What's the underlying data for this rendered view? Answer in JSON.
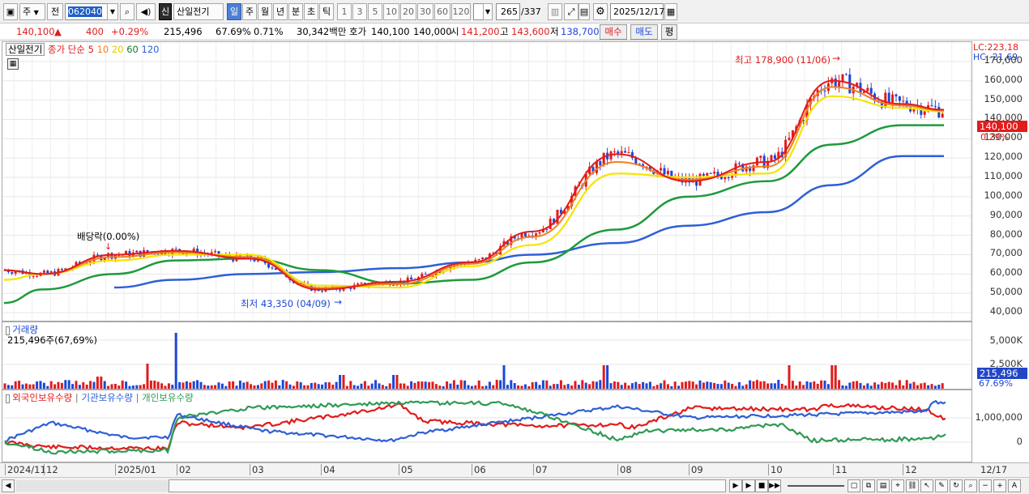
{
  "toolbar": {
    "period_select": "주",
    "view_select": "전",
    "stock_code": "062040",
    "stock_badge": "신",
    "stock_name": "산일전기",
    "periods": [
      "일",
      "주",
      "월",
      "년",
      "분",
      "초",
      "틱"
    ],
    "active_period": "일",
    "interval_buttons": [
      "1",
      "3",
      "5",
      "10",
      "20",
      "30",
      "60",
      "120"
    ],
    "count_value": "265",
    "count_total": "/337",
    "date_value": "2025/12/17"
  },
  "quote": {
    "price": "140,100",
    "change_arrow": "▲",
    "change": "400",
    "change_pct": "+0.29%",
    "volume": "215,496",
    "volume_ratio": "67.69%",
    "turnover_pct": "0.71%",
    "amount": "30,342백만",
    "ask_label": "호가",
    "ask": "140,100",
    "bid": "140,000",
    "open_label": "시",
    "open": "141,200",
    "high_label": "고",
    "high": "143,600",
    "low_label": "저",
    "low": "138,700",
    "buy_button": "매수",
    "sell_button": "매도",
    "eval_button": "평"
  },
  "price_panel": {
    "title": "산일전기",
    "legend_label": "종가 단순",
    "ma_labels": [
      "5",
      "10",
      "20",
      "60",
      "120"
    ],
    "lc": "LC:223,18",
    "hc": "HC:-21,69",
    "last_price_tag": "140,100",
    "last_pct_tag": "0.29%",
    "high_annotation": "최고 178,900 (11/06)",
    "low_annotation": "최저 43,350 (04/09)",
    "dividend_annotation": "배당락(0.00%)",
    "y_ticks": [
      "170,000",
      "160,000",
      "150,000",
      "140,000",
      "130,000",
      "120,000",
      "110,000",
      "100,000",
      "90,000",
      "80,000",
      "70,000",
      "60,000",
      "50,000",
      "40,000"
    ]
  },
  "volume_panel": {
    "title": "거래량",
    "info": "215,496주(67,69%)",
    "y_ticks": [
      "5,000K",
      "2,500K"
    ],
    "last_tag": "215,496",
    "last_pct": "67.69%"
  },
  "holding_panel": {
    "legend": [
      "외국인보유수량",
      "기관보유수량",
      "개인보유수량"
    ],
    "y_ticks": [
      "1,000,000",
      "0"
    ]
  },
  "dates": {
    "labels": [
      "2024/11",
      "12",
      "2025/01",
      "02",
      "03",
      "04",
      "05",
      "06",
      "07",
      "08",
      "09",
      "10",
      "11",
      "12"
    ],
    "right_label": "12/17"
  },
  "colors": {
    "up": "#e21b1b",
    "down": "#1c47d8",
    "ma5": "#e21b1b",
    "ma10": "#f08020",
    "ma20": "#f5e400",
    "ma60": "#1e9a3c",
    "ma120": "#2e5fd6",
    "foreign": "#e21b1b",
    "institution": "#2e5fd6",
    "individual": "#2f9a55"
  },
  "chart_data": {
    "type": "line",
    "title": "산일전기",
    "x": [
      "2024/11",
      "12",
      "2025/01",
      "02",
      "03",
      "04",
      "05",
      "06",
      "07",
      "08",
      "09",
      "10",
      "11",
      "12"
    ],
    "series": [
      {
        "name": "종가 단순 5",
        "values": [
          62000,
          60000,
          70000,
          72000,
          68000,
          52000,
          56000,
          66000,
          82000,
          122000,
          108000,
          118000,
          160000,
          148000
        ]
      },
      {
        "name": "종가 단순 20",
        "values": [
          57000,
          60000,
          67000,
          70000,
          70000,
          54000,
          53000,
          64000,
          75000,
          112000,
          110000,
          112000,
          152000,
          146000
        ]
      },
      {
        "name": "종가 단순 60",
        "values": [
          45000,
          52000,
          60000,
          67000,
          68000,
          62000,
          55000,
          57000,
          66000,
          83000,
          100000,
          108000,
          127000,
          137000
        ]
      },
      {
        "name": "종가 단순 120",
        "values": [
          null,
          null,
          53000,
          57000,
          60000,
          61000,
          63000,
          66000,
          70000,
          76000,
          85000,
          92000,
          106000,
          121000
        ]
      }
    ],
    "annotations": [
      "최고 178,900 (11/06)",
      "최저 43,350 (04/09)",
      "배당락(0.00%)"
    ],
    "ylim": [
      40000,
      175000
    ],
    "grid": true
  }
}
